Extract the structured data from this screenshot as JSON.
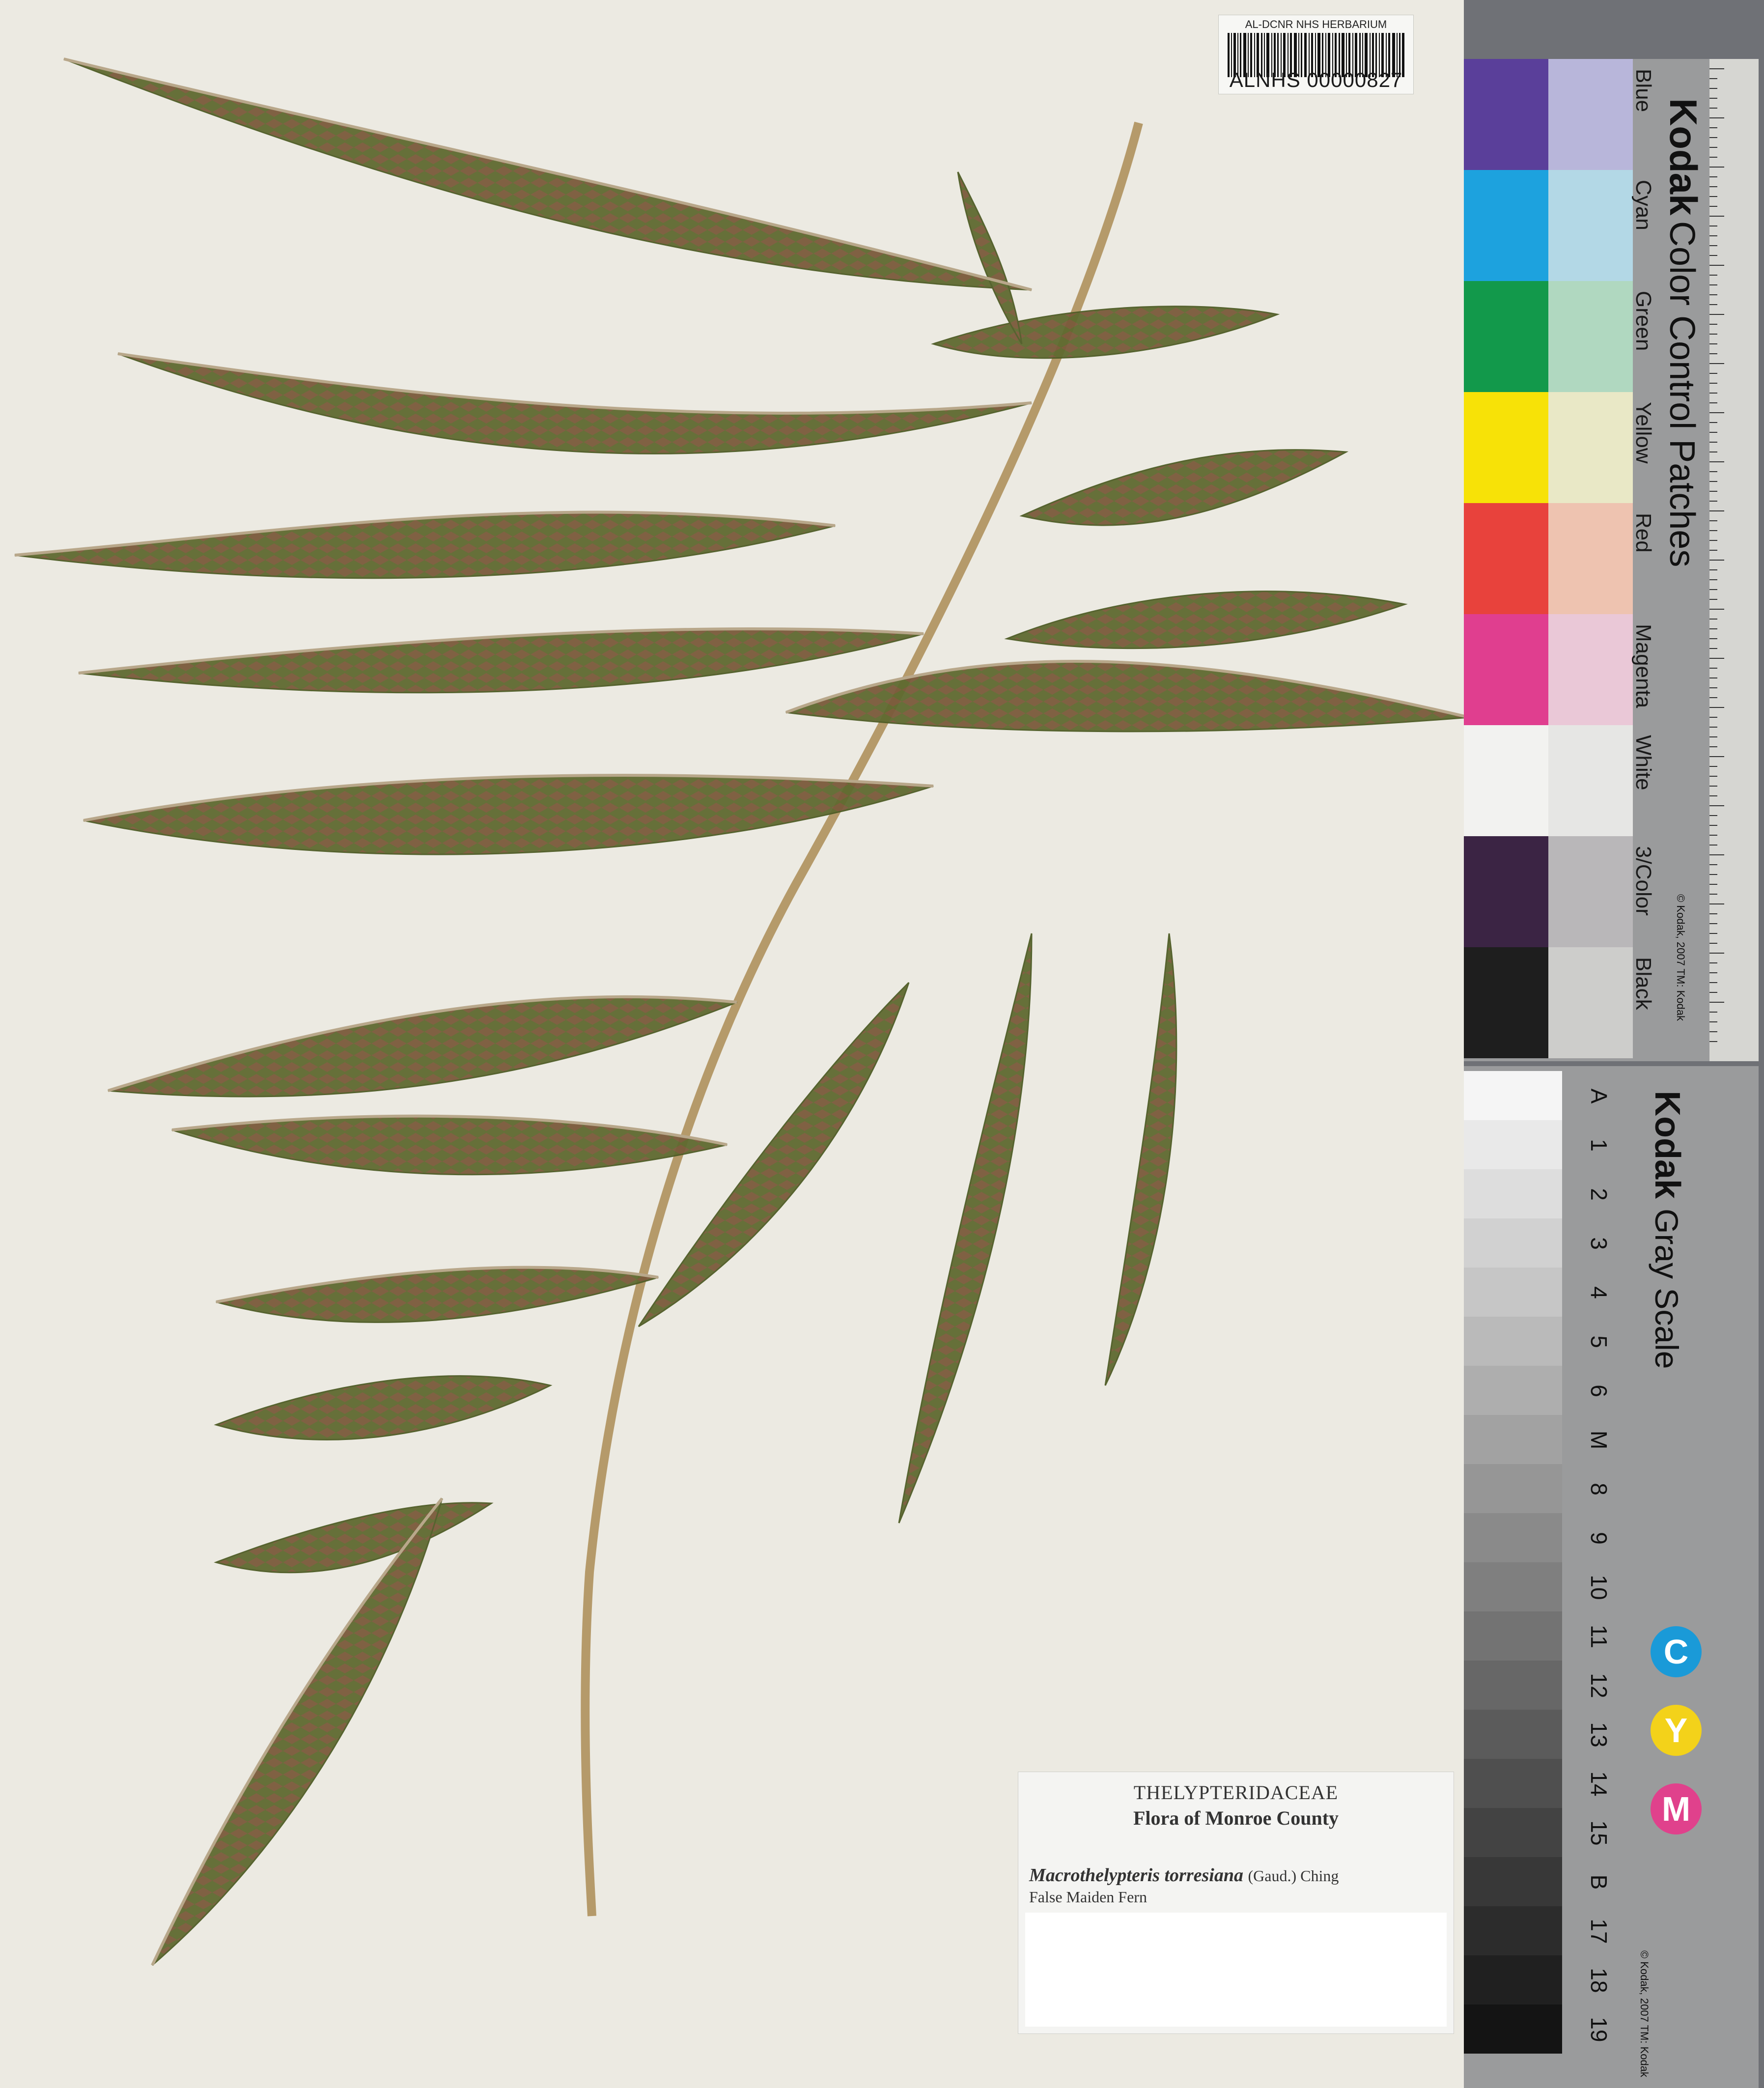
{
  "barcode_label": {
    "institution": "AL-DCNR NHS HERBARIUM",
    "catalog_number": "ALNHS 00000827"
  },
  "determination_label": {
    "family": "THELYPTERIDACEAE",
    "flora": "Flora of Monroe County",
    "scientific_name": "Macrothelypteris torresiana",
    "authority": "(Gaud.) Ching",
    "common_name": "False Maiden Fern"
  },
  "color_card": {
    "brand": "Kodak",
    "title": "Color Control Patches",
    "patches": [
      {
        "name": "Blue",
        "dark": "#5a3f9a",
        "light": "#b8b6da"
      },
      {
        "name": "Cyan",
        "dark": "#1da2de",
        "light": "#b3d8e6"
      },
      {
        "name": "Green",
        "dark": "#12994b",
        "light": "#b0d8c0"
      },
      {
        "name": "Yellow",
        "dark": "#f7e207",
        "light": "#e9e8c6"
      },
      {
        "name": "Red",
        "dark": "#e8423c",
        "light": "#eec3b0"
      },
      {
        "name": "Magenta",
        "dark": "#e03e8f",
        "light": "#eac8d7"
      },
      {
        "name": "White",
        "dark": "#f2f2f0",
        "light": "#e6e6e4"
      },
      {
        "name": "3/Color",
        "dark": "#3b2444",
        "light": "#b9b7b9"
      },
      {
        "name": "Black",
        "dark": "#1e1e1e",
        "light": "#cdcdcb"
      }
    ],
    "copyright": "© Kodak, 2007 TM: Kodak",
    "ruler_units": [
      "cm",
      "inches"
    ]
  },
  "gray_card": {
    "brand": "Kodak",
    "title": "Gray Scale",
    "steps": [
      "A",
      "1",
      "2",
      "3",
      "4",
      "5",
      "6",
      "M",
      "8",
      "9",
      "10",
      "11",
      "12",
      "13",
      "14",
      "15",
      "B",
      "17",
      "18",
      "19"
    ],
    "cmy": [
      "C",
      "Y",
      "M"
    ],
    "cmy_colors": [
      "#1a9ad8",
      "#f3d21a",
      "#e0418c"
    ],
    "copyright": "© Kodak, 2007 TM: Kodak"
  }
}
